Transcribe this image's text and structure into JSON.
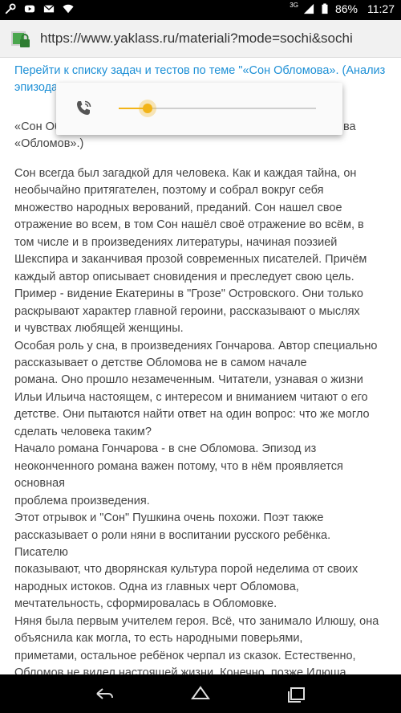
{
  "status_bar": {
    "network": "3G",
    "battery": "86%",
    "time": "11:27",
    "left_icons": [
      "wrench-icon",
      "youtube-icon",
      "mail-icon",
      "wifi-icon"
    ]
  },
  "browser": {
    "url": "https://www.yaklass.ru/materiali?mode=sochi&sochi"
  },
  "page": {
    "link_line1": "Перейти к списку задач и тестов по теме \"«Сон Обломова». (Анализ",
    "link_line2": "эпизода",
    "quote_line1": "«Сон Об",
    "quote_line1_end": "ва",
    "quote_line2": "«Обломов».)",
    "paragraph_lines": [
      "Сон всегда был загадкой для человека. Как и каждая тайна, он",
      "необычайно притягателен, поэтому и собрал вокруг себя",
      "множество народных верований, преданий. Сон нашел свое",
      "отражение во всем, в том Сон нашёл своё отражение во всём, в",
      "том числе и в произведениях литературы, начиная поэзией",
      "Шекспира и заканчивая прозой современных писателей. Причём",
      "каждый автор описывает сновидения и преследует свою цель.",
      "Пример - видение Екатерины в \"Грозе\" Островского. Они только",
      "раскрывают характер главной героини, рассказывают о мыслях",
      "и чувствах любящей женщины.",
      "Особая роль у сна, в произведениях Гончарова. Автор специально",
      "рассказывает о детстве Обломова не в самом начале",
      "романа. Оно прошло незамеченным. Читатели, узнавая о жизни",
      "Ильи Ильича настоящем, с интересом и вниманием читают о его",
      "детстве. Они пытаются найти ответ на один вопрос: что же могло",
      "сделать человека таким?",
      "Начало романа Гончарова - в сне Обломова. Эпизод из",
      "неоконченного романа важен потому, что в нём проявляется",
      "основная",
      "проблема произведения.",
      "Этот отрывок и \"Сон\" Пушкина очень похожи. Поэт также",
      "рассказывает о роли няни в воспитании русского ребёнка.",
      "Писателю",
      "показывают, что дворянская культура порой неделима от своих",
      "народных истоков. Одна из главных черт Обломова,",
      "мечтательность, сформировалась в Обломовке.",
      "Няня была первым учителем героя. Всё, что занимало Илюшу, она",
      "объяснила как могла, то есть народными поверьями,",
      "приметами, остальное ребёнок черпал из сказок. Естественно,",
      "Обломов не видел настоящей жизни. Конечно, позже Илюша"
    ]
  },
  "volume_popup": {
    "icon": "phone-call-icon",
    "level": 0.145,
    "accent_color": "#f2b418"
  },
  "nav": {
    "buttons": [
      "back-icon",
      "home-icon",
      "recents-icon"
    ]
  }
}
